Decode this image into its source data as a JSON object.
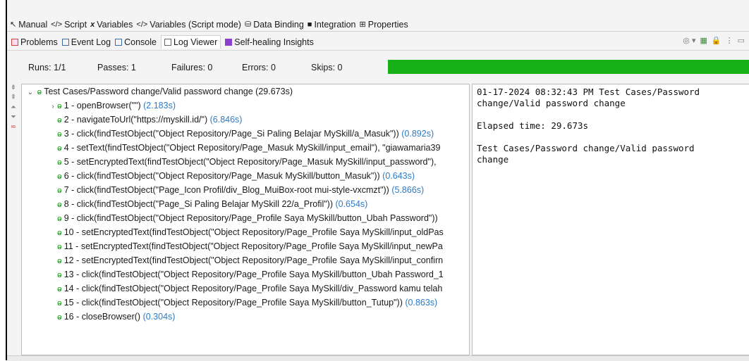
{
  "top_tabs": [
    {
      "icon": "manual-icon",
      "label": "Manual"
    },
    {
      "icon": "script-icon",
      "label": "Script"
    },
    {
      "icon": "variables-icon",
      "label": "Variables"
    },
    {
      "icon": "script-mode-icon",
      "label": "Variables (Script mode)"
    },
    {
      "icon": "database-icon",
      "label": "Data Binding"
    },
    {
      "icon": "integration-icon",
      "label": "Integration"
    },
    {
      "icon": "properties-icon",
      "label": "Properties"
    }
  ],
  "bottom_tabs": [
    {
      "icon": "problems-icon",
      "label": "Problems"
    },
    {
      "icon": "event-log-icon",
      "label": "Event Log"
    },
    {
      "icon": "console-icon",
      "label": "Console"
    },
    {
      "icon": "log-viewer-icon",
      "label": "Log Viewer"
    },
    {
      "icon": "self-healing-icon",
      "label": "Self-healing Insights"
    }
  ],
  "stats": {
    "runs": "Runs: 1/1",
    "passes": "Passes: 1",
    "failures": "Failures: 0",
    "errors": "Errors: 0",
    "skips": "Skips: 0",
    "progress_fraction": 1.0,
    "progress_color": "#17b117"
  },
  "tree": {
    "root": {
      "label": "Test Cases/Password change/Valid password change",
      "duration": "(29.673s)"
    },
    "steps": [
      {
        "label": "1 - openBrowser(\"\")",
        "duration": "(2.183s)",
        "expandable": true
      },
      {
        "label": "2 - navigateToUrl(\"https://myskill.id/\")",
        "duration": "(6.846s)"
      },
      {
        "label": "3 - click(findTestObject(\"Object Repository/Page_Si Paling Belajar  MySkill/a_Masuk\"))",
        "duration": "(0.892s)"
      },
      {
        "label": "4 - setText(findTestObject(\"Object Repository/Page_Masuk  MySkill/input_email\"), \"giawamaria39",
        "duration": ""
      },
      {
        "label": "5 - setEncryptedText(findTestObject(\"Object Repository/Page_Masuk  MySkill/input_password\"),",
        "duration": ""
      },
      {
        "label": "6 - click(findTestObject(\"Object Repository/Page_Masuk  MySkill/button_Masuk\"))",
        "duration": "(0.643s)"
      },
      {
        "label": "7 - click(findTestObject(\"Page_Icon Profil/div_Blog_MuiBox-root mui-style-vxcmzt\"))",
        "duration": "(5.866s)"
      },
      {
        "label": "8 - click(findTestObject(\"Page_Si Paling Belajar  MySkill 22/a_Profil\"))",
        "duration": "(0.654s)"
      },
      {
        "label": "9 - click(findTestObject(\"Object Repository/Page_Profile Saya  MySkill/button_Ubah Password\"))",
        "duration": ""
      },
      {
        "label": "10 - setEncryptedText(findTestObject(\"Object Repository/Page_Profile Saya  MySkill/input_oldPas",
        "duration": ""
      },
      {
        "label": "11 - setEncryptedText(findTestObject(\"Object Repository/Page_Profile Saya  MySkill/input_newPa",
        "duration": ""
      },
      {
        "label": "12 - setEncryptedText(findTestObject(\"Object Repository/Page_Profile Saya  MySkill/input_confirn",
        "duration": ""
      },
      {
        "label": "13 - click(findTestObject(\"Object Repository/Page_Profile Saya  MySkill/button_Ubah Password_1",
        "duration": ""
      },
      {
        "label": "14 - click(findTestObject(\"Object Repository/Page_Profile Saya  MySkill/div_Password kamu telah",
        "duration": ""
      },
      {
        "label": "15 - click(findTestObject(\"Object Repository/Page_Profile Saya  MySkill/button_Tutup\"))",
        "duration": "(0.863s)"
      },
      {
        "label": "16 - closeBrowser()",
        "duration": "(0.304s)"
      }
    ]
  },
  "detail": {
    "line1": "01-17-2024 08:32:43 PM Test Cases/Password\nchange/Valid password change",
    "line2": "Elapsed time: 29.673s",
    "line3": "Test Cases/Password change/Valid password\nchange"
  }
}
